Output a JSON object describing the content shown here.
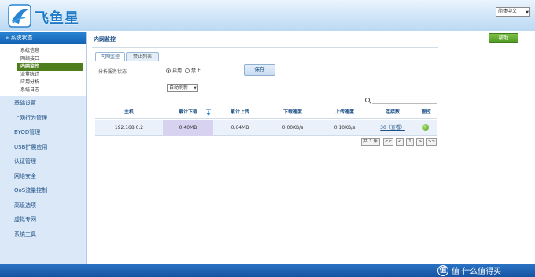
{
  "header": {
    "logo_text": "飞鱼星",
    "language": "简体中文"
  },
  "sidebar": {
    "section_title": "系统状态",
    "sub_items": [
      {
        "label": "系统信息"
      },
      {
        "label": "网络接口"
      },
      {
        "label": "内网监控"
      },
      {
        "label": "流量统计"
      },
      {
        "label": "应用分析"
      },
      {
        "label": "系统日志"
      }
    ],
    "items": [
      {
        "label": "基础设置"
      },
      {
        "label": "上网行为管理"
      },
      {
        "label": "BYOD管理"
      },
      {
        "label": "USB扩展应用"
      },
      {
        "label": "认证管理"
      },
      {
        "label": "网络安全"
      },
      {
        "label": "QoS流量控制"
      },
      {
        "label": "高级选项"
      },
      {
        "label": "虚拟专网"
      },
      {
        "label": "系统工具"
      }
    ]
  },
  "main": {
    "title": "内网监控",
    "help_label": "帮助",
    "tabs": [
      {
        "label": "内网监控"
      },
      {
        "label": "禁止列表"
      }
    ],
    "service_label": "分析服务状态",
    "radio_enable": "启用",
    "radio_disable": "禁止",
    "save_label": "保存",
    "refresh_select": "自动刷新"
  },
  "table": {
    "headers": [
      "主机",
      "累计下载",
      "累计上传",
      "下载速度",
      "上传速度",
      "连接数",
      "管控"
    ],
    "rows": [
      {
        "host": "192.168.0.2",
        "download_total": "0.40MB",
        "upload_total": "0.64MB",
        "download_speed": "0.00KB/s",
        "upload_speed": "0.10KB/s",
        "connections": "30（查看）"
      }
    ]
  },
  "pager": {
    "total": "共 1 条",
    "first": "<<",
    "prev": "<",
    "page": "1",
    "next": ">",
    "last": ">>"
  },
  "footer": {
    "watermark": "值 什么值得买"
  },
  "colors": {
    "accent": "#1c4f86",
    "active_nav": "#4e7d1c",
    "help_button": "#5fa82c",
    "footer": "#1a5fb0"
  }
}
